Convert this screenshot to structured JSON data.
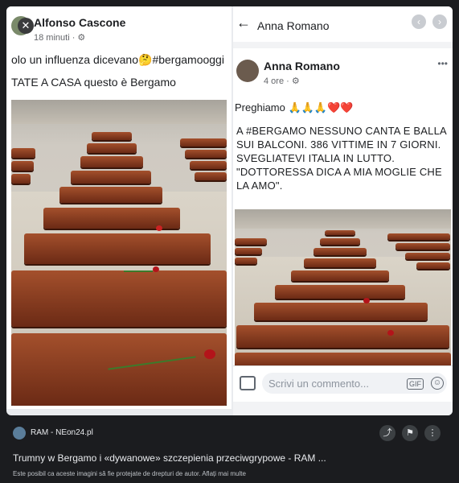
{
  "left_post": {
    "author": "Alfonso Cascone",
    "meta": "18 minuti · ⚙",
    "text_line1": "olo un influenza dicevano🤔#bergamooggi",
    "text_line2": "TATE A CASA questo è Bergamo",
    "close_icon": "close-icon"
  },
  "right_post": {
    "top_title": "Anna Romano",
    "author": "Anna Romano",
    "meta": "4 ore · ⚙",
    "text_line1": "Preghiamo 🙏🙏🙏❤️❤️",
    "text_body": "A #BERGAMO NESSUNO CANTA E BALLA SUI BALCONI. 386 VITTIME IN 7 GIORNI. SVEGLIATEVI ITALIA IN LUTTO. \"DOTTORESSA DICA A MIA MOGLIE CHE LA AMO\".",
    "comment_placeholder": "Scrivi un commento...",
    "gif_label": "GIF"
  },
  "result": {
    "source": "RAM - NEon24.pl",
    "caption": "Trumny w Bergamo i «dywanowe» szczepienia przeciwgrypowe - RAM ...",
    "copyright": "Este posibil ca aceste imagini să fie protejate de drepturi de autor.",
    "learn_more": "Aflați mai multe"
  }
}
